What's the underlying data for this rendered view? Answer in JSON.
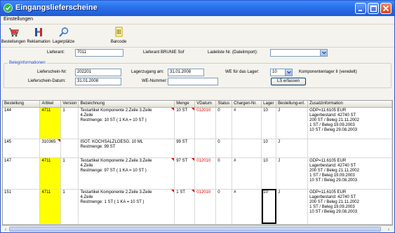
{
  "window": {
    "title": "Eingangslieferscheine",
    "accent": "#2a6ee8"
  },
  "menubar": {
    "items": [
      "Einstellungen"
    ]
  },
  "toolbar": {
    "buttons": [
      {
        "label": "Bestellungen",
        "icon": "shopping-cart-icon"
      },
      {
        "label": "Reklamation",
        "icon": "return-icon"
      },
      {
        "label": "Lagerplätze",
        "icon": "magnifier-icon"
      },
      {
        "label": "Barcode",
        "icon": "barcode-icon"
      }
    ]
  },
  "form": {
    "lieferant_label": "Lieferant:",
    "lieferant_value": "7011",
    "lieferant_name_label": "Lieferant BRUNIE Sof",
    "ladeliste_label": "Ladeliste Nr. (Dateiimport):",
    "ladeliste_value": "",
    "group_title": "Beleginformationen",
    "lieferschein_nr_label": "Lieferschein-Nr:",
    "lieferschein_nr_value": "202201",
    "lagerzugang_label": "Lagerzugang am:",
    "lagerzugang_value": "31.01.2008",
    "we_lager_label": "WE für das Lager:",
    "we_lager_value": "10",
    "komponentenlager_label": "Komponentenlager II (veredelt)",
    "lieferschein_datum_label": "Lieferschein-Datum:",
    "lieferschein_datum_value": "31.01.2008",
    "we_nummer_label": "WE-Nummer:",
    "we_nummer_value": "",
    "ls_erfassen_label": "LS erfassen"
  },
  "grid": {
    "columns": [
      "Bestellung",
      "Artikel",
      "Version",
      "Bezeichnung",
      "Menge",
      "VDatum",
      "Status",
      "Chargen-Nr.",
      "Lager",
      "Bestellung-erl.",
      "Zusatzinformation"
    ],
    "rows": [
      {
        "bestellung": "144",
        "artikel": "4711",
        "version": "1",
        "bezeichnung": "Testartikel Komponente 2.Zeile 3.Zeile\n4.Zeile\nRestmenge: 10 ST ( 1 KA = 10 ST )",
        "menge": "10 ST",
        "vdatum": "012010",
        "status": "0",
        "chargen": "#",
        "lager": "10",
        "erl": "J",
        "zusatz": "GDP=11.6105 EUR\nLagerbestand: 42740 ST\n200 ST / Beleg 21.11.2002\n1 ST / Beleg 19.09.2003\n10 ST / Beleg 29.08.2003"
      },
      {
        "bestellung": "145",
        "artikel": "310365",
        "version": "",
        "bezeichnung": "ISOT. KOCHSALZLOESG. 10 ML\nRestmenge: 99 ST",
        "menge": "99 ST",
        "vdatum": "",
        "status": "0",
        "chargen": "",
        "lager": "10",
        "erl": "J",
        "zusatz": ""
      },
      {
        "bestellung": "147",
        "artikel": "4711",
        "version": "1",
        "bezeichnung": "Testartikel Komponente 2.Zeile 3.Zeile\n4.Zeile\nRestmenge: 97 ST ( 1 KA = 10 ST )",
        "menge": "97 ST",
        "vdatum": "012010",
        "status": "0",
        "chargen": "#",
        "lager": "10",
        "erl": "J",
        "zusatz": "GDP=11.6105 EUR\nLagerbestand: 42740 ST\n200 ST / Beleg 21.11.2002\n1 ST / Beleg 19.09.2003\n10 ST / Beleg 29.08.2003"
      },
      {
        "bestellung": "151",
        "artikel": "4711",
        "version": "1",
        "bezeichnung": "Testartikel Komponente 2.Zeile 3.Zeile\n4.Zeile\nRestmenge: 1 ST ( 1 KA = 10 ST )",
        "menge": "1 ST",
        "vdatum": "012010",
        "status": "0",
        "chargen": "#",
        "lager": "10",
        "erl": "J",
        "zusatz": "GDP=11.6105 EUR\nLagerbestand: 42740 ST\n200 ST / Beleg 21.11.2002\n1 ST / Beleg 19.09.2003\n10 ST / Beleg 29.08.2003"
      }
    ]
  }
}
